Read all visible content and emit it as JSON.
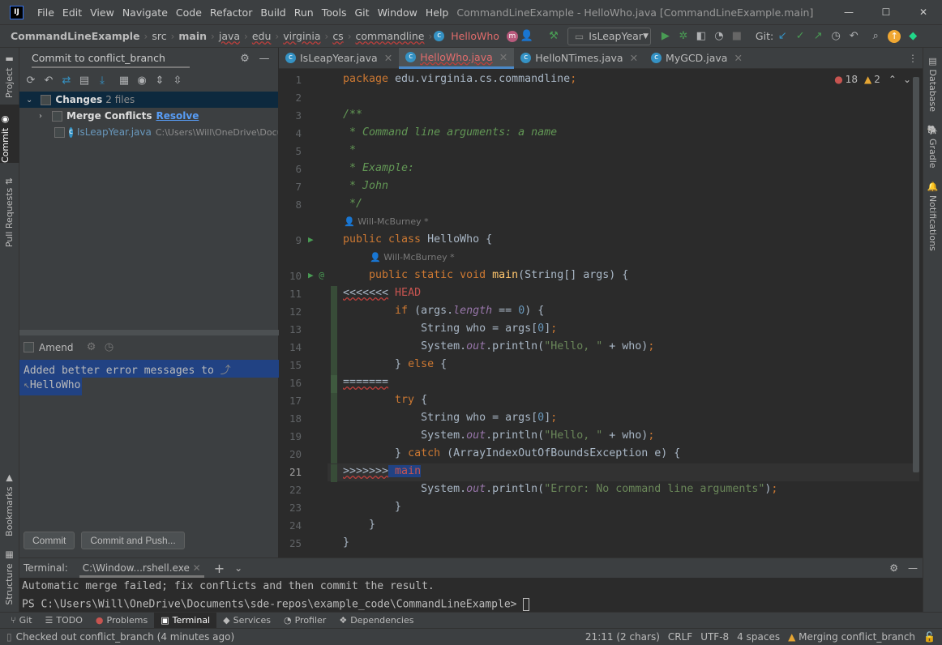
{
  "app": {
    "logo": "IJ",
    "menu": [
      "File",
      "Edit",
      "View",
      "Navigate",
      "Code",
      "Refactor",
      "Build",
      "Run",
      "Tools",
      "Git",
      "Window",
      "Help"
    ],
    "window_title": "CommandLineExample - HelloWho.java [CommandLineExample.main]"
  },
  "breadcrumb": [
    "CommandLineExample",
    "src",
    "main",
    "java",
    "edu",
    "virginia",
    "cs",
    "commandline",
    "HelloWho"
  ],
  "run_config": "IsLeapYear",
  "git_label": "Git:",
  "left_strip": [
    "Project",
    "Commit",
    "Pull Requests",
    "Bookmarks",
    "Structure"
  ],
  "right_strip": [
    "Database",
    "Gradle",
    "Notifications"
  ],
  "commit": {
    "title": "Commit to conflict_branch",
    "changes_label": "Changes",
    "changes_count": "2 files",
    "merge_label": "Merge Conflicts",
    "resolve": "Resolve",
    "file": "IsLeapYear.java",
    "file_path": "C:\\Users\\Will\\OneDrive\\Docu",
    "amend": "Amend",
    "message_line1": "Added better error messages to",
    "message_line2": "HelloWho",
    "commit_btn": "Commit",
    "commit_push_btn": "Commit and Push..."
  },
  "tabs": [
    {
      "label": "IsLeapYear.java"
    },
    {
      "label": "HelloWho.java",
      "active": true
    },
    {
      "label": "HelloNTimes.java"
    },
    {
      "label": "MyGCD.java"
    }
  ],
  "inspections": {
    "errors": "18",
    "warnings": "2"
  },
  "author_hint": "Will-McBurney *",
  "code": [
    [
      [
        "package ",
        "kw"
      ],
      [
        "edu.virginia.cs.commandline",
        "pl"
      ],
      [
        ";",
        "kw"
      ]
    ],
    [],
    [
      [
        "/**",
        "cm"
      ]
    ],
    [
      [
        " * Command line arguments: a name",
        "cm"
      ]
    ],
    [
      [
        " *",
        "cm"
      ]
    ],
    [
      [
        " * Example:",
        "cm"
      ]
    ],
    [
      [
        " * John",
        "cm"
      ]
    ],
    [
      [
        " */",
        "cm"
      ]
    ],
    [
      [
        "public class ",
        "kw"
      ],
      [
        "HelloWho {",
        "pl"
      ]
    ],
    [
      [
        "    public static void ",
        "kw"
      ],
      [
        "main",
        "fn"
      ],
      [
        "(String[] args) {",
        "pl"
      ]
    ],
    [
      [
        "<<<<<<<",
        "mk"
      ],
      [
        " HEAD",
        "hd"
      ]
    ],
    [
      [
        "        ",
        "pl"
      ],
      [
        "if ",
        "kw"
      ],
      [
        "(args.",
        "pl"
      ],
      [
        "length",
        "fld"
      ],
      [
        " == ",
        "pl"
      ],
      [
        "0",
        "num"
      ],
      [
        ") {",
        "pl"
      ]
    ],
    [
      [
        "            String who = args[",
        "pl"
      ],
      [
        "0",
        "num"
      ],
      [
        "]",
        "pl"
      ],
      [
        ";",
        "kw"
      ]
    ],
    [
      [
        "            System.",
        "pl"
      ],
      [
        "out",
        "fld"
      ],
      [
        ".println(",
        "pl"
      ],
      [
        "\"Hello, \"",
        "str"
      ],
      [
        " + who)",
        "pl"
      ],
      [
        ";",
        "kw"
      ]
    ],
    [
      [
        "        } ",
        "pl"
      ],
      [
        "else ",
        "kw"
      ],
      [
        "{",
        "pl"
      ]
    ],
    [
      [
        "=======",
        "mk"
      ]
    ],
    [
      [
        "        ",
        "pl"
      ],
      [
        "try ",
        "kw"
      ],
      [
        "{",
        "pl"
      ]
    ],
    [
      [
        "            String who = args[",
        "pl"
      ],
      [
        "0",
        "num"
      ],
      [
        "]",
        "pl"
      ],
      [
        ";",
        "kw"
      ]
    ],
    [
      [
        "            System.",
        "pl"
      ],
      [
        "out",
        "fld"
      ],
      [
        ".println(",
        "pl"
      ],
      [
        "\"Hello, \"",
        "str"
      ],
      [
        " + who)",
        "pl"
      ],
      [
        ";",
        "kw"
      ]
    ],
    [
      [
        "        } ",
        "pl"
      ],
      [
        "catch ",
        "kw"
      ],
      [
        "(ArrayIndexOutOfBoundsException e) {",
        "pl"
      ]
    ],
    [
      [
        ">>>>>>>",
        "mk"
      ],
      [
        " main",
        "hd"
      ]
    ],
    [
      [
        "            System.",
        "pl"
      ],
      [
        "out",
        "fld"
      ],
      [
        ".println(",
        "pl"
      ],
      [
        "\"Error: No command line arguments\"",
        "str"
      ],
      [
        ")",
        "pl"
      ],
      [
        ";",
        "kw"
      ]
    ],
    [
      [
        "        }",
        "pl"
      ]
    ],
    [
      [
        "    }",
        "pl"
      ]
    ],
    [
      [
        "}",
        "pl"
      ]
    ]
  ],
  "terminal": {
    "label": "Terminal:",
    "tab": "C:\\Window...rshell.exe",
    "line1": "Automatic merge failed; fix conflicts and then commit the result.",
    "line2": "PS C:\\Users\\Will\\OneDrive\\Documents\\sde-repos\\example_code\\CommandLineExample>"
  },
  "tool_windows": [
    {
      "label": "Git",
      "icon": "git-branch-icon"
    },
    {
      "label": "TODO",
      "icon": "list-icon"
    },
    {
      "label": "Problems",
      "icon": "error-icon"
    },
    {
      "label": "Terminal",
      "icon": "terminal-icon",
      "active": true
    },
    {
      "label": "Services",
      "icon": "services-icon"
    },
    {
      "label": "Profiler",
      "icon": "profiler-icon"
    },
    {
      "label": "Dependencies",
      "icon": "dependencies-icon"
    }
  ],
  "status": {
    "message": "Checked out conflict_branch (4 minutes ago)",
    "position": "21:11 (2 chars)",
    "line_sep": "CRLF",
    "encoding": "UTF-8",
    "indent": "4 spaces",
    "branch": "Merging conflict_branch"
  }
}
